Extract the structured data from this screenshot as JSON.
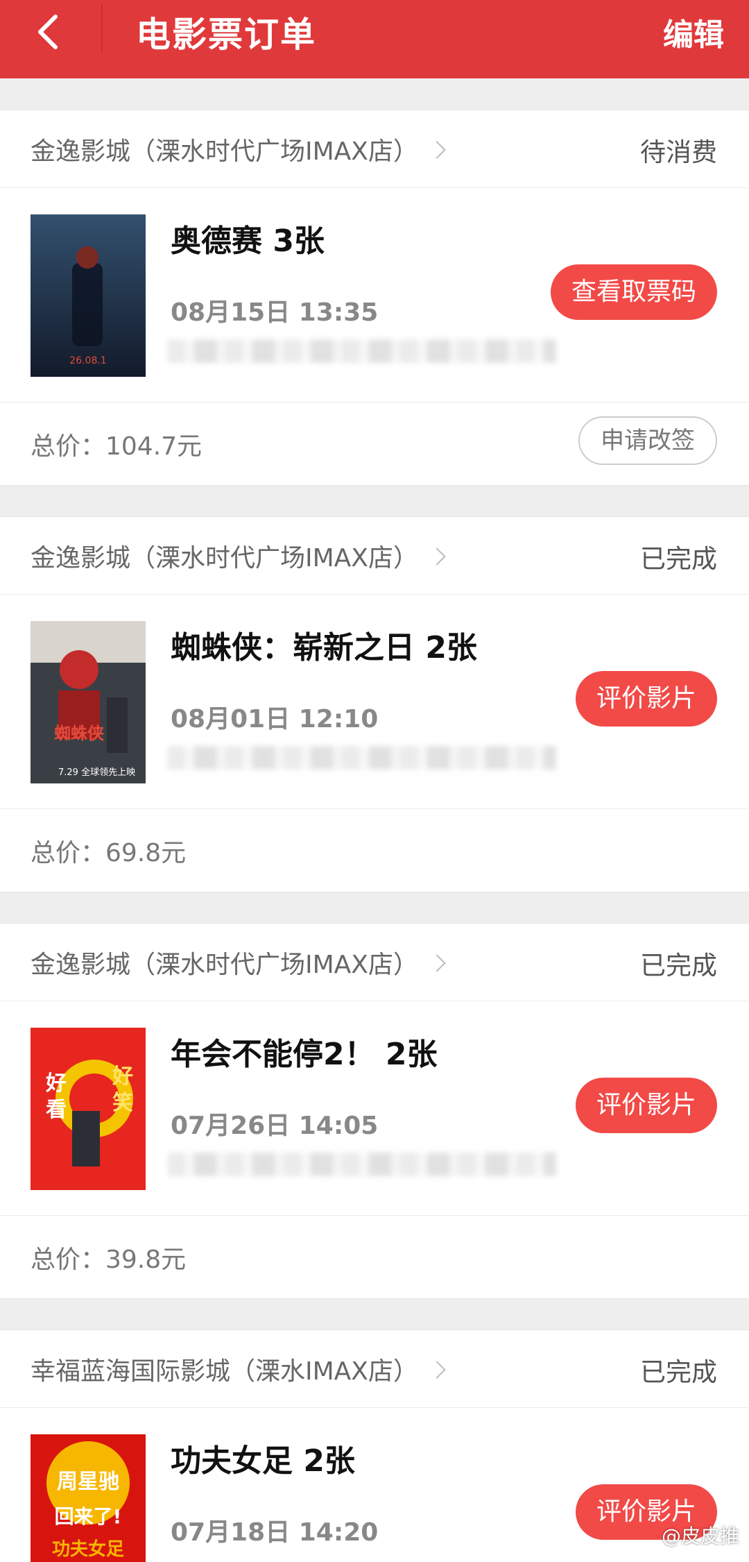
{
  "header": {
    "title": "电影票订单",
    "edit_label": "编辑"
  },
  "orders": [
    {
      "cinema": "金逸影城（溧水时代广场IMAX店）",
      "status": "待消费",
      "movie": "奥德赛 3张",
      "showtime": "08月15日 13:35",
      "action": "查看取票码",
      "price": "总价：104.7元",
      "secondary_action": "申请改签",
      "poster_colors": [
        "#1b2a40",
        "#4a5d78"
      ]
    },
    {
      "cinema": "金逸影城（溧水时代广场IMAX店）",
      "status": "已完成",
      "movie": "蜘蛛侠：崭新之日 2张",
      "showtime": "08月01日 12:10",
      "action": "评价影片",
      "price": "总价：69.8元",
      "poster_colors": [
        "#d9d4cc",
        "#5b3b3b"
      ]
    },
    {
      "cinema": "金逸影城（溧水时代广场IMAX店）",
      "status": "已完成",
      "movie": "年会不能停2！ 2张",
      "showtime": "07月26日 14:05",
      "action": "评价影片",
      "price": "总价：39.8元",
      "poster_colors": [
        "#e6261f",
        "#f5c400"
      ]
    },
    {
      "cinema": "幸福蓝海国际影城（溧水IMAX店）",
      "status": "已完成",
      "movie": "功夫女足 2张",
      "showtime": "07月18日 14:20",
      "action": "评价影片",
      "poster_colors": [
        "#f7b700",
        "#d8140f"
      ]
    }
  ],
  "watermark": "@皮皮推"
}
